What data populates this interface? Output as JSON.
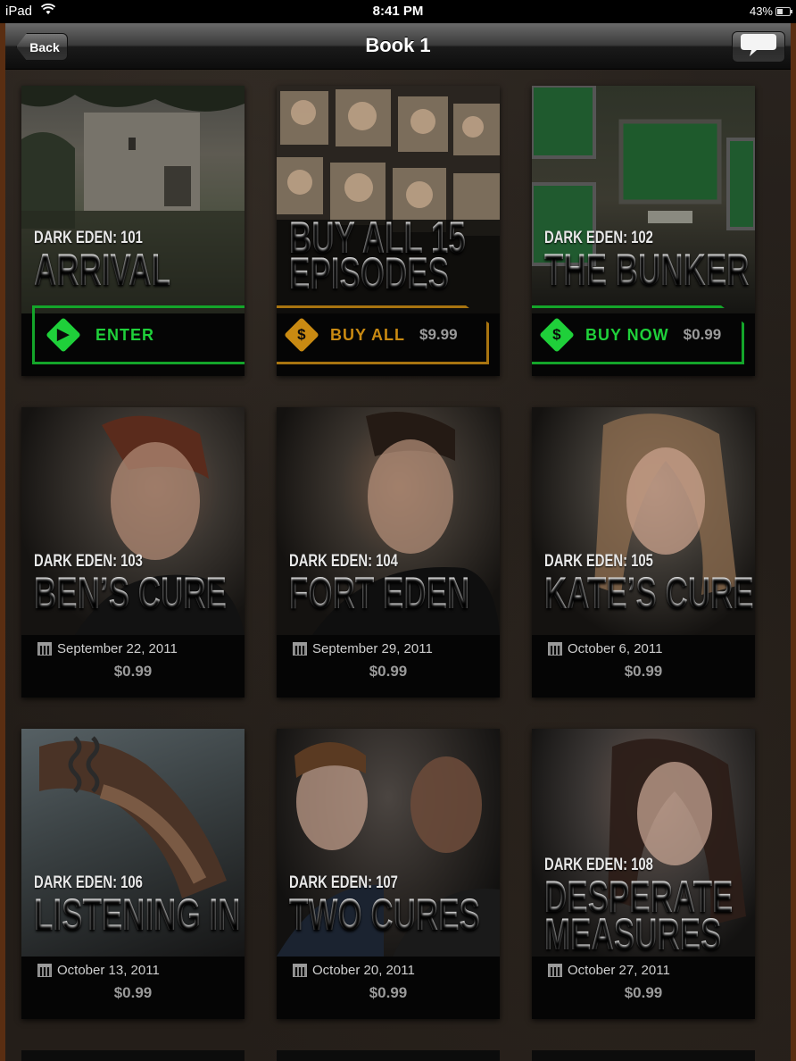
{
  "status_bar": {
    "carrier": "iPad",
    "time": "8:41 PM",
    "battery": "43%"
  },
  "nav": {
    "back_label": "Back",
    "title": "Book 1"
  },
  "cards": [
    {
      "series": "DARK EDEN: 101",
      "title": "ARRIVAL",
      "action_label": "ENTER",
      "action_price": ""
    },
    {
      "series": "",
      "title_lines": [
        "BUY ALL 15",
        "EPISODES"
      ],
      "action_label": "BUY ALL",
      "action_price": "$9.99"
    },
    {
      "series": "DARK EDEN: 102",
      "title": "THE BUNKER",
      "action_label": "BUY NOW",
      "action_price": "$0.99"
    },
    {
      "series": "DARK EDEN: 103",
      "title": "BEN’S CURE",
      "date": "September 22, 2011",
      "price": "$0.99"
    },
    {
      "series": "DARK EDEN: 104",
      "title": "FORT EDEN",
      "date": "September 29, 2011",
      "price": "$0.99"
    },
    {
      "series": "DARK EDEN: 105",
      "title": "KATE’S CURE",
      "date": "October 6, 2011",
      "price": "$0.99"
    },
    {
      "series": "DARK EDEN: 106",
      "title": "LISTENING IN",
      "date": "October 13, 2011",
      "price": "$0.99"
    },
    {
      "series": "DARK EDEN: 107",
      "title": "TWO CURES",
      "date": "October 20, 2011",
      "price": "$0.99"
    },
    {
      "series": "DARK EDEN: 108",
      "title_lines": [
        "DESPERATE",
        "MEASURES"
      ],
      "date": "October 27, 2011",
      "price": "$0.99"
    }
  ],
  "icons": {
    "enter": "play-icon",
    "buy_all": "dollar-icon",
    "buy_now": "dollar-icon",
    "date": "calendar-icon",
    "chat": "speech-bubble-icon"
  },
  "colors": {
    "enter_green": "#1fd03a",
    "buy_all_orange": "#c98a12",
    "buy_now_green": "#1fd03a"
  }
}
